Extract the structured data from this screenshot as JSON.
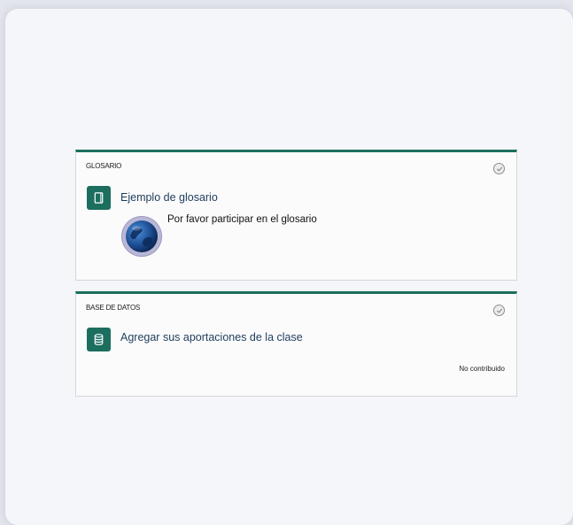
{
  "activities": [
    {
      "type_label": "GLOSARIO",
      "title": "Ejemplo de glosario",
      "icon": "glossary-icon",
      "description": "Por favor participar en el glosario",
      "image": "globe-icon"
    },
    {
      "type_label": "BASE DE DATOS",
      "title": "Agregar sus aportaciones de la clase",
      "icon": "database-icon",
      "status": "No contribuido"
    }
  ],
  "colors": {
    "accent": "#1c6e5e",
    "title_text": "#1e3d5c",
    "background": "#f5f6fa"
  }
}
